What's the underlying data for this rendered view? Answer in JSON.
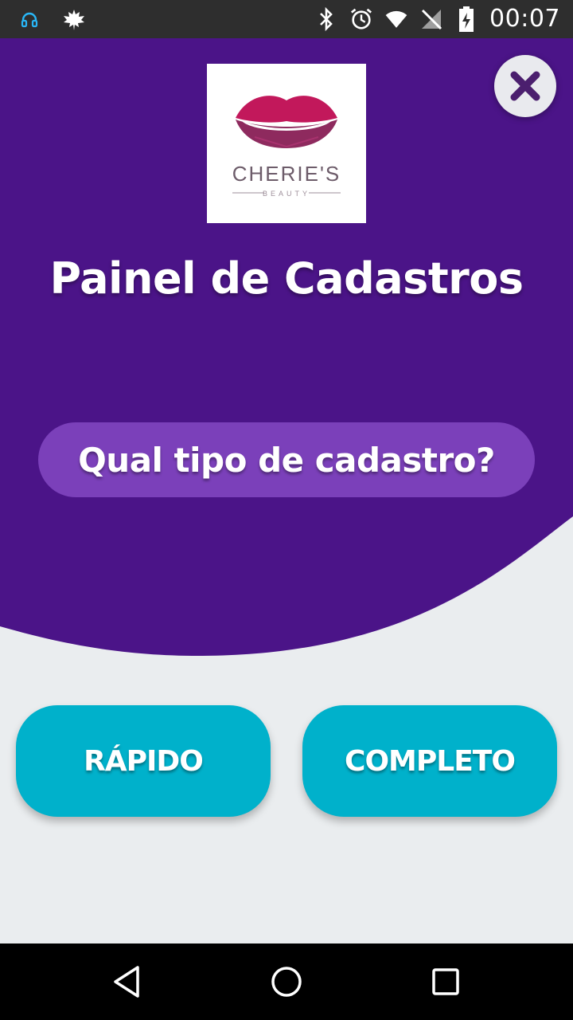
{
  "status_bar": {
    "time": "00:07",
    "icons": [
      "headset-icon",
      "leaf-icon",
      "bluetooth-icon",
      "alarm-icon",
      "wifi-icon",
      "no-signal-icon",
      "battery-charging-icon"
    ]
  },
  "logo": {
    "brand_name": "CHERIE'S",
    "brand_sub": "BEAUTY"
  },
  "header": {
    "title": "Painel de Cadastros",
    "question": "Qual tipo de cadastro?"
  },
  "actions": {
    "quick_label": "RÁPIDO",
    "complete_label": "COMPLETO"
  },
  "colors": {
    "purple": "#4b1488",
    "pill_purple": "#7b40ba",
    "button_cyan": "#00b1cb",
    "background": "#eaedef"
  },
  "nav": {
    "icons": [
      "back-icon",
      "home-icon",
      "recents-icon"
    ]
  }
}
